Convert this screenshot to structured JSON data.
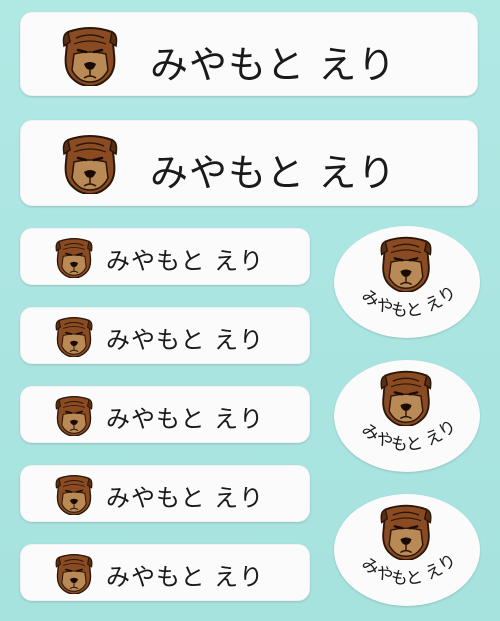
{
  "sheet": {
    "name_text": "みやもと えり",
    "background_color": "#a8e4e0",
    "label_color": "#fbfbfb",
    "icon": "dog-face-icon"
  },
  "large_labels": [
    {
      "name": "みやもと えり"
    },
    {
      "name": "みやもと えり"
    }
  ],
  "small_labels": [
    {
      "name": "みやもと えり"
    },
    {
      "name": "みやもと えり"
    },
    {
      "name": "みやもと えり"
    },
    {
      "name": "みやもと えり"
    },
    {
      "name": "みやもと えり"
    }
  ],
  "oval_labels": [
    {
      "name": "みやもと えり"
    },
    {
      "name": "みやもと えり"
    },
    {
      "name": "みやもと えり"
    }
  ]
}
